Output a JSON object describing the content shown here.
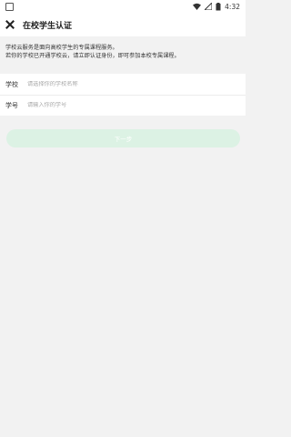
{
  "status_bar": {
    "time": "4:32"
  },
  "app_bar": {
    "title": "在校学生认证"
  },
  "info": {
    "line1": "学校云服务是面向高校学生的专属课程服务。",
    "line2": "若你的学校已开通学校云，请立即认证身份，即可参加本校专属课程。"
  },
  "form": {
    "school_label": "学校",
    "school_placeholder": "请选择你的学校名称",
    "id_label": "学号",
    "id_placeholder": "请输入你的学号"
  },
  "next_button": {
    "label": "下一步"
  },
  "colors": {
    "button_bg": "#dcf2e4",
    "page_bg": "#f2f2f2"
  }
}
